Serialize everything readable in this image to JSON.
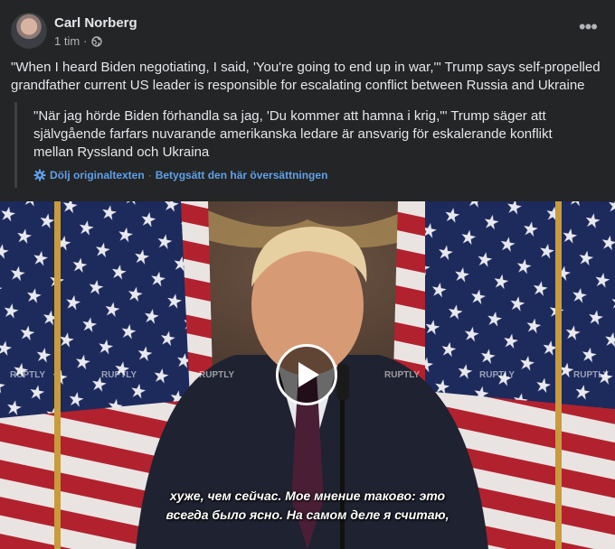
{
  "post": {
    "author": "Carl Norberg",
    "timestamp": "1 tim",
    "separator": "·",
    "privacy_icon": "globe-icon",
    "more_icon": "more-horizontal-icon",
    "text": "\"When I heard Biden negotiating, I said, 'You're going to end up in war,'\" Trump says self-propelled grandfather current US leader is responsible for escalating conflict between Russia and Ukraine"
  },
  "translation": {
    "text": "\"När jag hörde Biden förhandla sa jag, 'Du kommer att hamna i krig,'\" Trump säger att självgående farfars nuvarande amerikanska ledare är ansvarig för eskalerande konflikt mellan Ryssland och Ukraina",
    "hide_label": "Dölj originaltexten",
    "separator": "·",
    "rate_label": "Betygsätt den här översättningen",
    "settings_icon": "gear-icon"
  },
  "video": {
    "play_icon": "play-icon",
    "subtitle_line1": "хуже, чем сейчас. Мое мнение таково: это",
    "subtitle_line2": "всегда было ясно. На самом деле я считаю,",
    "watermark": "RUPTLY",
    "colors": {
      "flag_red": "#b2222e",
      "flag_blue": "#1d2a5c",
      "suit": "#1f2230"
    }
  }
}
